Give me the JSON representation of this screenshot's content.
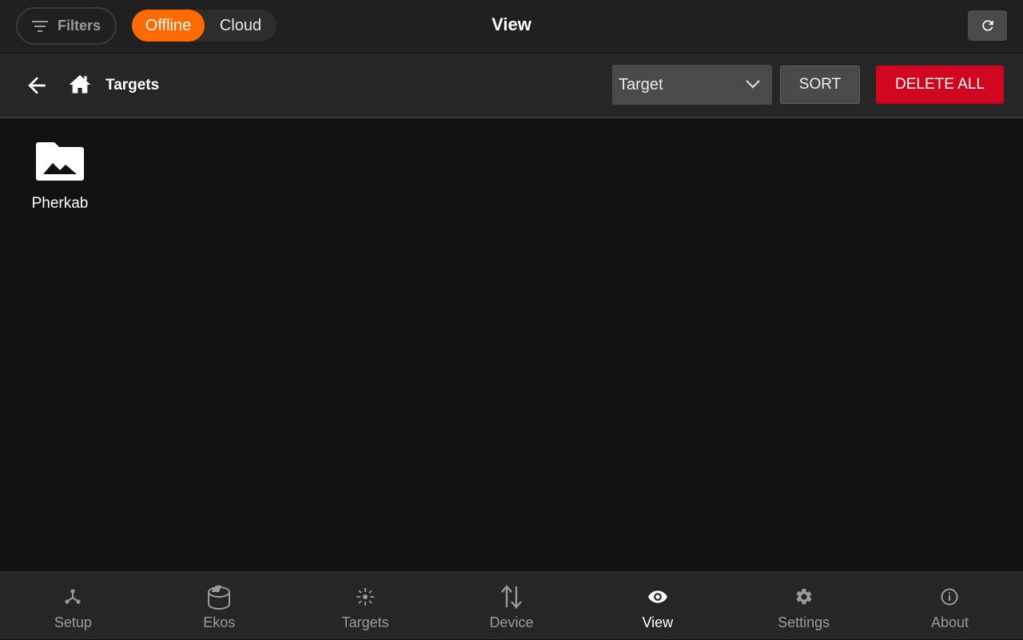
{
  "header": {
    "filters_label": "Filters",
    "mode_offline": "Offline",
    "mode_cloud": "Cloud",
    "title": "View",
    "refresh_icon": "refresh-icon"
  },
  "toolbar": {
    "breadcrumb": "Targets",
    "sort_select_value": "Target",
    "sort_label": "SORT",
    "delete_all_label": "DELETE ALL"
  },
  "folders": [
    {
      "name": "Pherkab",
      "icon": "image-folder-icon"
    }
  ],
  "nav": {
    "items": [
      {
        "label": "Setup",
        "icon": "setup-icon"
      },
      {
        "label": "Ekos",
        "icon": "ekos-icon"
      },
      {
        "label": "Targets",
        "icon": "targets-icon"
      },
      {
        "label": "Device",
        "icon": "device-icon"
      },
      {
        "label": "View",
        "icon": "eye-icon",
        "active": true
      },
      {
        "label": "Settings",
        "icon": "gear-icon"
      },
      {
        "label": "About",
        "icon": "info-icon"
      }
    ]
  },
  "colors": {
    "accent": "#ff6a00",
    "danger": "#d0061e"
  }
}
